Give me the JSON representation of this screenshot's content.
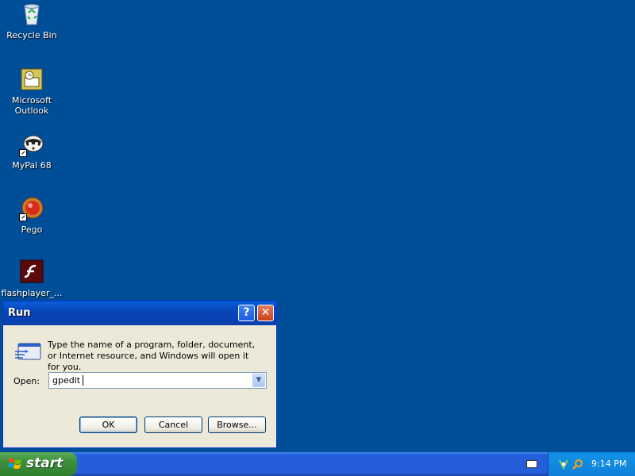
{
  "desktop": {
    "icons": [
      {
        "label": "Recycle Bin",
        "icon": "recycle-bin-icon"
      },
      {
        "label": "Microsoft Outlook",
        "icon": "outlook-icon"
      },
      {
        "label": "MyPal 68",
        "icon": "mypal-icon"
      },
      {
        "label": "Pego",
        "icon": "pego-icon"
      },
      {
        "label": "flashplayer_...",
        "icon": "flash-icon"
      }
    ]
  },
  "run_dialog": {
    "title": "Run",
    "help_glyph": "?",
    "close_glyph": "✕",
    "description": "Type the name of a program, folder, document, or Internet resource, and Windows will open it for you.",
    "open_label": "Open:",
    "open_value": "gpedit",
    "dropdown_glyph": "▼",
    "buttons": {
      "ok": "OK",
      "cancel": "Cancel",
      "browse": "Browse..."
    }
  },
  "taskbar": {
    "start_label": "start",
    "clock": "9:14 PM"
  },
  "colors": {
    "desktop": "#004e98",
    "titlebar": "#0845b8",
    "start_button": "#3c8f3b",
    "tray": "#0f80d7"
  }
}
